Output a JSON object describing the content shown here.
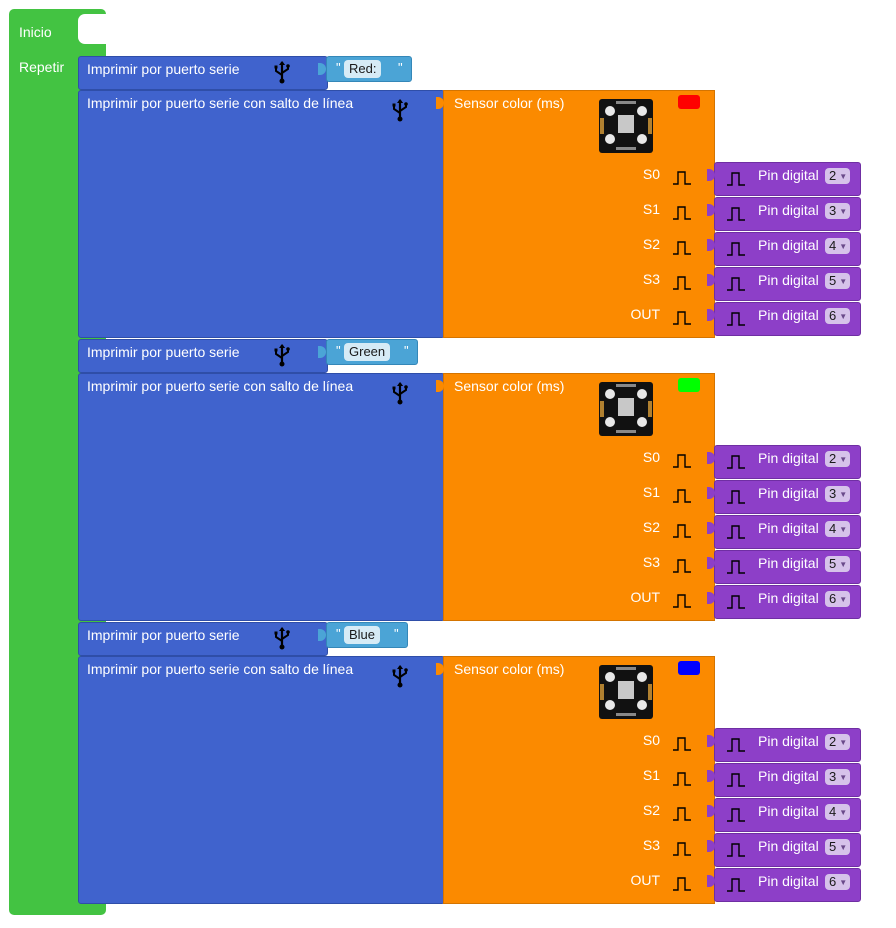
{
  "program": {
    "start_label": "Inicio",
    "loop_label": "Repetir",
    "groups": [
      {
        "print_label": "Imprimir por puerto serie",
        "text_value": "Red:",
        "println_label": "Imprimir por puerto serie con salto de línea",
        "sensor_label": "Sensor color (ms)",
        "sensor_color": "#ff0000",
        "pins": [
          {
            "name": "S0",
            "pin_label": "Pin digital",
            "value": "2"
          },
          {
            "name": "S1",
            "pin_label": "Pin digital",
            "value": "3"
          },
          {
            "name": "S2",
            "pin_label": "Pin digital",
            "value": "4"
          },
          {
            "name": "S3",
            "pin_label": "Pin digital",
            "value": "5"
          },
          {
            "name": "OUT",
            "pin_label": "Pin digital",
            "value": "6"
          }
        ]
      },
      {
        "print_label": "Imprimir por puerto serie",
        "text_value": "Green",
        "println_label": "Imprimir por puerto serie con salto de línea",
        "sensor_label": "Sensor color (ms)",
        "sensor_color": "#00ff00",
        "pins": [
          {
            "name": "S0",
            "pin_label": "Pin digital",
            "value": "2"
          },
          {
            "name": "S1",
            "pin_label": "Pin digital",
            "value": "3"
          },
          {
            "name": "S2",
            "pin_label": "Pin digital",
            "value": "4"
          },
          {
            "name": "S3",
            "pin_label": "Pin digital",
            "value": "5"
          },
          {
            "name": "OUT",
            "pin_label": "Pin digital",
            "value": "6"
          }
        ]
      },
      {
        "print_label": "Imprimir por puerto serie",
        "text_value": "Blue",
        "println_label": "Imprimir por puerto serie con salto de línea",
        "sensor_label": "Sensor color (ms)",
        "sensor_color": "#0000ff",
        "pins": [
          {
            "name": "S0",
            "pin_label": "Pin digital",
            "value": "2"
          },
          {
            "name": "S1",
            "pin_label": "Pin digital",
            "value": "3"
          },
          {
            "name": "S2",
            "pin_label": "Pin digital",
            "value": "4"
          },
          {
            "name": "S3",
            "pin_label": "Pin digital",
            "value": "5"
          },
          {
            "name": "OUT",
            "pin_label": "Pin digital",
            "value": "6"
          }
        ]
      }
    ]
  },
  "icons": {
    "usb": "usb-icon",
    "pulse": "pulse-icon",
    "sensor": "color-sensor-board-image"
  }
}
